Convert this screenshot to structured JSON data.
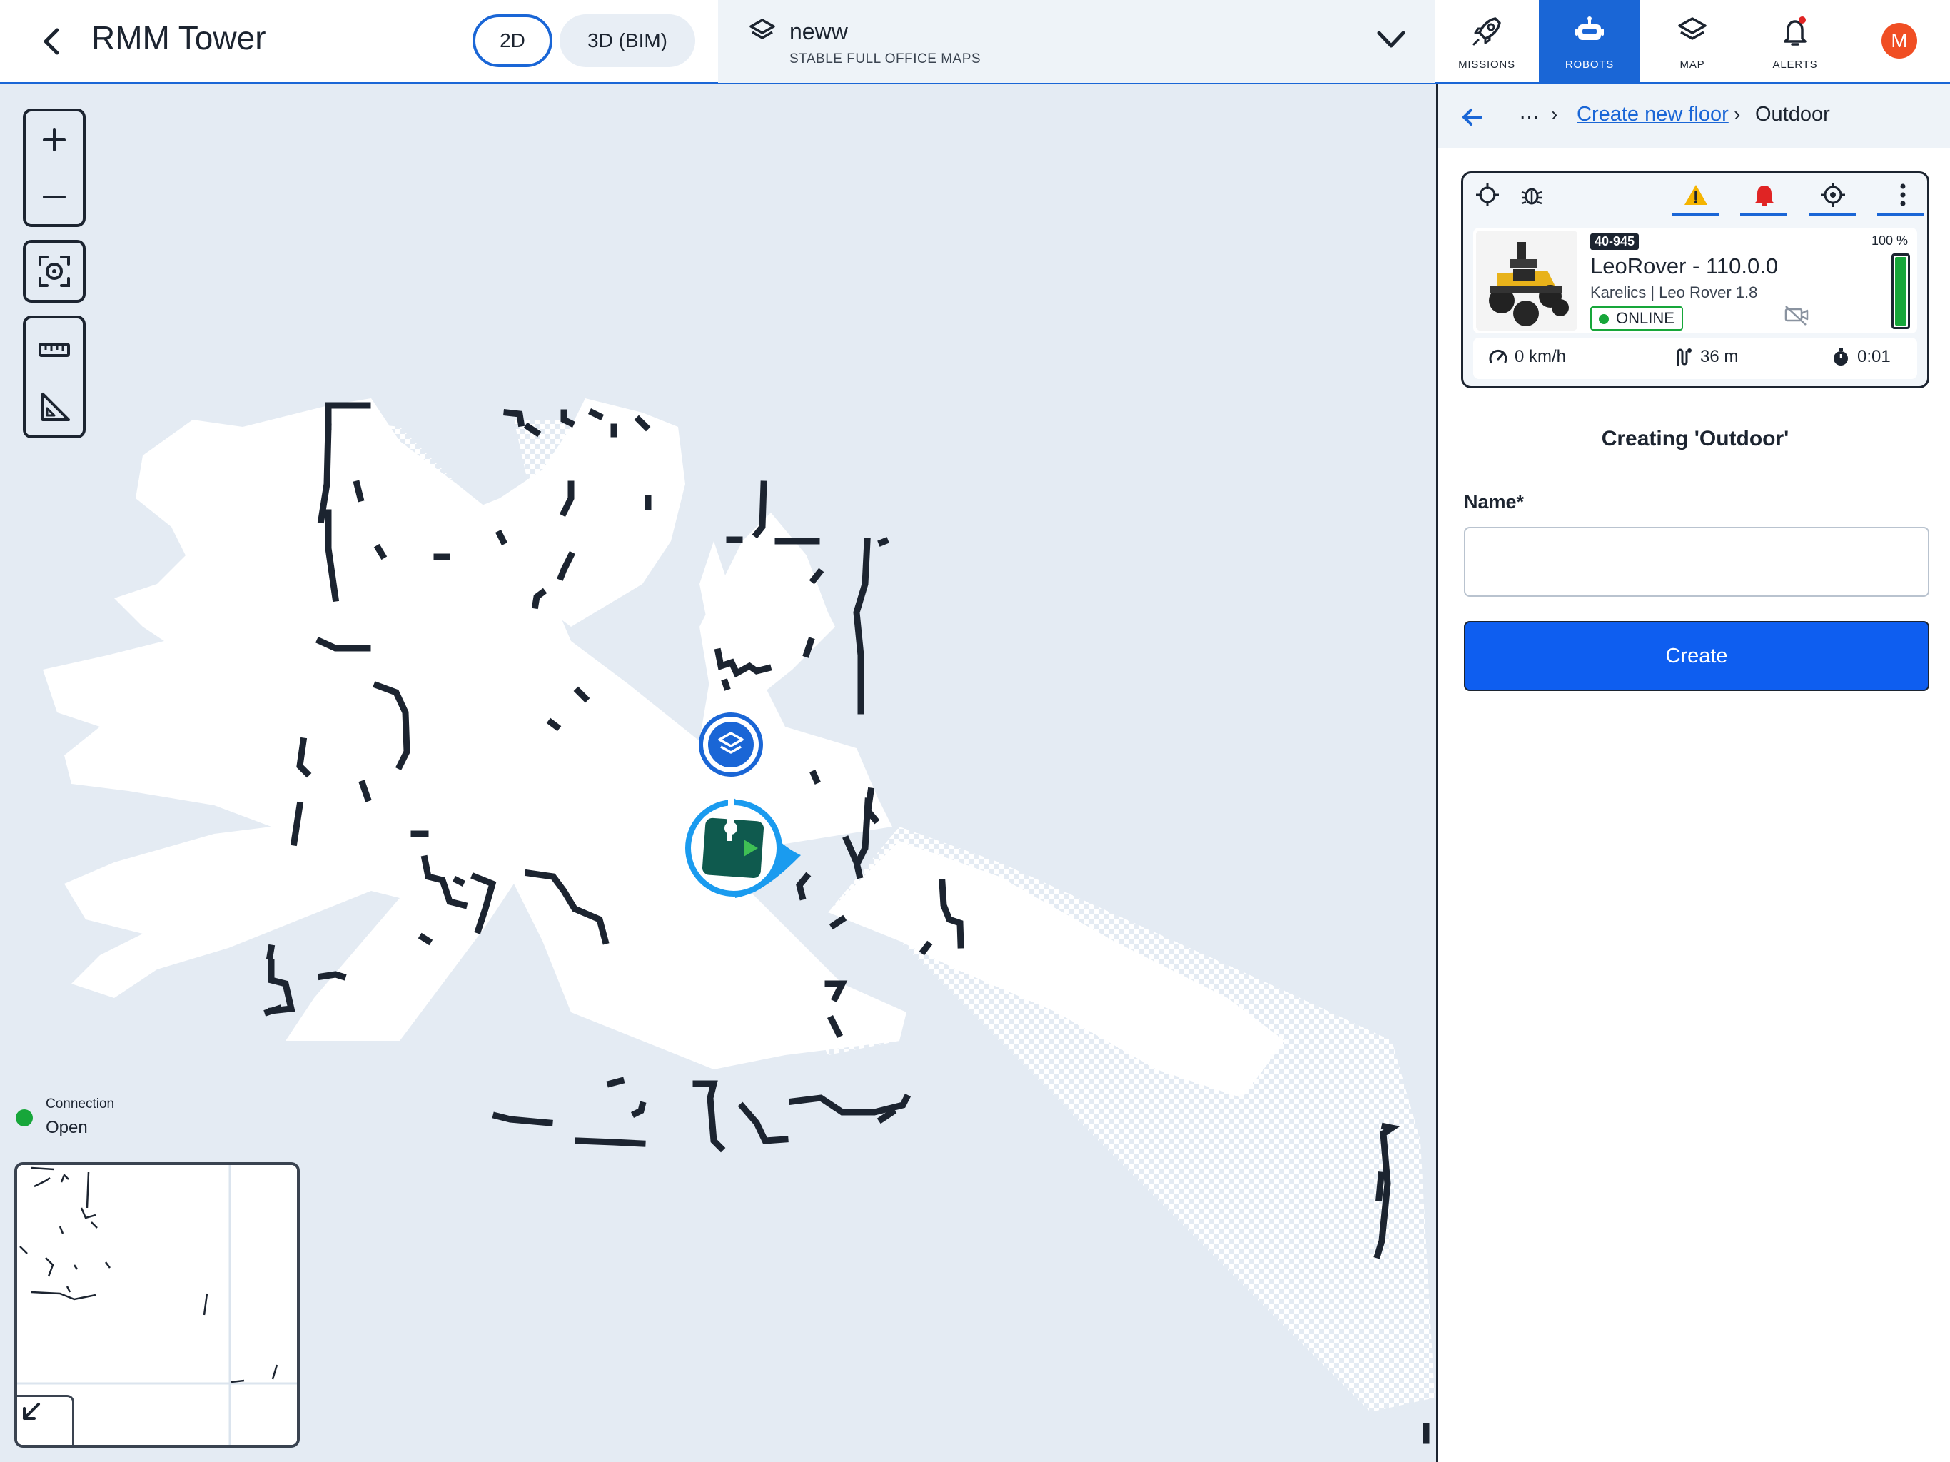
{
  "header": {
    "title": "RMM Tower",
    "view_2d": "2D",
    "view_3d": "3D (BIM)",
    "map_name": "neww",
    "map_subtitle": "STABLE FULL OFFICE MAPS",
    "nav": [
      {
        "label": "MISSIONS",
        "icon": "rocket-icon"
      },
      {
        "label": "ROBOTS",
        "icon": "robot-icon",
        "active": true
      },
      {
        "label": "MAP",
        "icon": "layers-icon"
      },
      {
        "label": "ALERTS",
        "icon": "bell-icon"
      }
    ],
    "avatar_initial": "M",
    "accent_color": "#1a66d6"
  },
  "map": {
    "connection_label": "Connection",
    "connection_status": "Open",
    "connection_color": "#17a63a"
  },
  "panel": {
    "breadcrumb": {
      "ellipsis": "...",
      "link": "Create new floor",
      "current": "Outdoor"
    },
    "robot": {
      "id": "40-945",
      "name": "LeoRover - 110.0.0",
      "model": "Karelics | Leo Rover 1.8",
      "status": "ONLINE",
      "battery_pct": 100,
      "battery_label": "100 %",
      "speed": "0 km/h",
      "distance": "36 m",
      "time": "0:01"
    },
    "form": {
      "title": "Creating 'Outdoor'",
      "name_label": "Name*",
      "name_value": "",
      "create_label": "Create"
    }
  }
}
